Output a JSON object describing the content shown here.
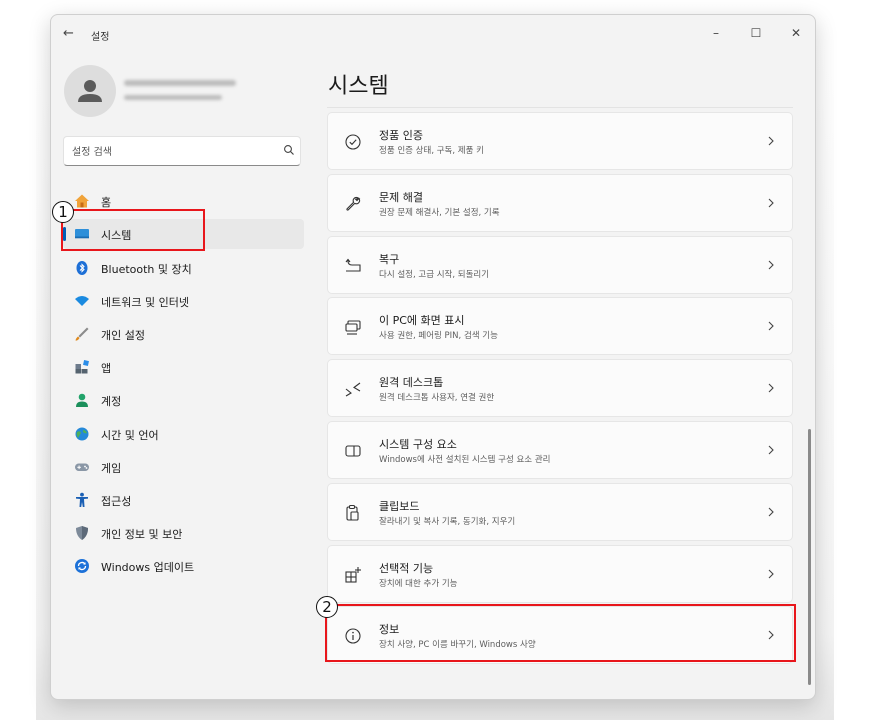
{
  "window": {
    "title": "설정",
    "back_icon": "back-arrow-icon",
    "controls": {
      "minimize": "–",
      "maximize": "☐",
      "close": "✕"
    }
  },
  "sidebar": {
    "search_placeholder": "설정 검색",
    "items": [
      {
        "label": "홈",
        "icon": "home-icon"
      },
      {
        "label": "시스템",
        "icon": "system-icon",
        "selected": true
      },
      {
        "label": "Bluetooth 및 장치",
        "icon": "bluetooth-icon"
      },
      {
        "label": "네트워크 및 인터넷",
        "icon": "network-icon"
      },
      {
        "label": "개인 설정",
        "icon": "brush-icon"
      },
      {
        "label": "앱",
        "icon": "apps-icon"
      },
      {
        "label": "계정",
        "icon": "account-icon"
      },
      {
        "label": "시간 및 언어",
        "icon": "globe-icon"
      },
      {
        "label": "게임",
        "icon": "gamepad-icon"
      },
      {
        "label": "접근성",
        "icon": "accessibility-icon"
      },
      {
        "label": "개인 정보 및 보안",
        "icon": "shield-icon"
      },
      {
        "label": "Windows 업데이트",
        "icon": "update-icon"
      }
    ]
  },
  "main": {
    "page_title": "시스템",
    "cards": [
      {
        "title": "정품 인증",
        "subtitle": "정품 인증 상태, 구독, 제품 키",
        "icon": "activation-check-icon"
      },
      {
        "title": "문제 해결",
        "subtitle": "권장 문제 해결사, 기본 설정, 기록",
        "icon": "wrench-icon"
      },
      {
        "title": "복구",
        "subtitle": "다시 설정, 고급 시작, 되돌리기",
        "icon": "recovery-icon"
      },
      {
        "title": "이 PC에 화면 표시",
        "subtitle": "사용 권한, 페어링 PIN, 검색 기능",
        "icon": "project-screen-icon"
      },
      {
        "title": "원격 데스크톱",
        "subtitle": "원격 데스크톱 사용자, 연결 권한",
        "icon": "remote-desktop-icon"
      },
      {
        "title": "시스템 구성 요소",
        "subtitle": "Windows에 사전 설치된 시스템 구성 요소 관리",
        "icon": "components-icon"
      },
      {
        "title": "클립보드",
        "subtitle": "잘라내기 및 복사 기록, 동기화, 지우기",
        "icon": "clipboard-icon"
      },
      {
        "title": "선택적 기능",
        "subtitle": "장치에 대한 추가 기능",
        "icon": "optional-features-icon"
      },
      {
        "title": "정보",
        "subtitle": "장치 사양, PC 이름 바꾸기, Windows 사양",
        "icon": "info-icon"
      }
    ]
  },
  "annotations": [
    {
      "number": "1",
      "target": "sidebar-item-system"
    },
    {
      "number": "2",
      "target": "card-about"
    }
  ],
  "colors": {
    "accent": "#005fb8",
    "annotation_red": "#e8161b"
  }
}
